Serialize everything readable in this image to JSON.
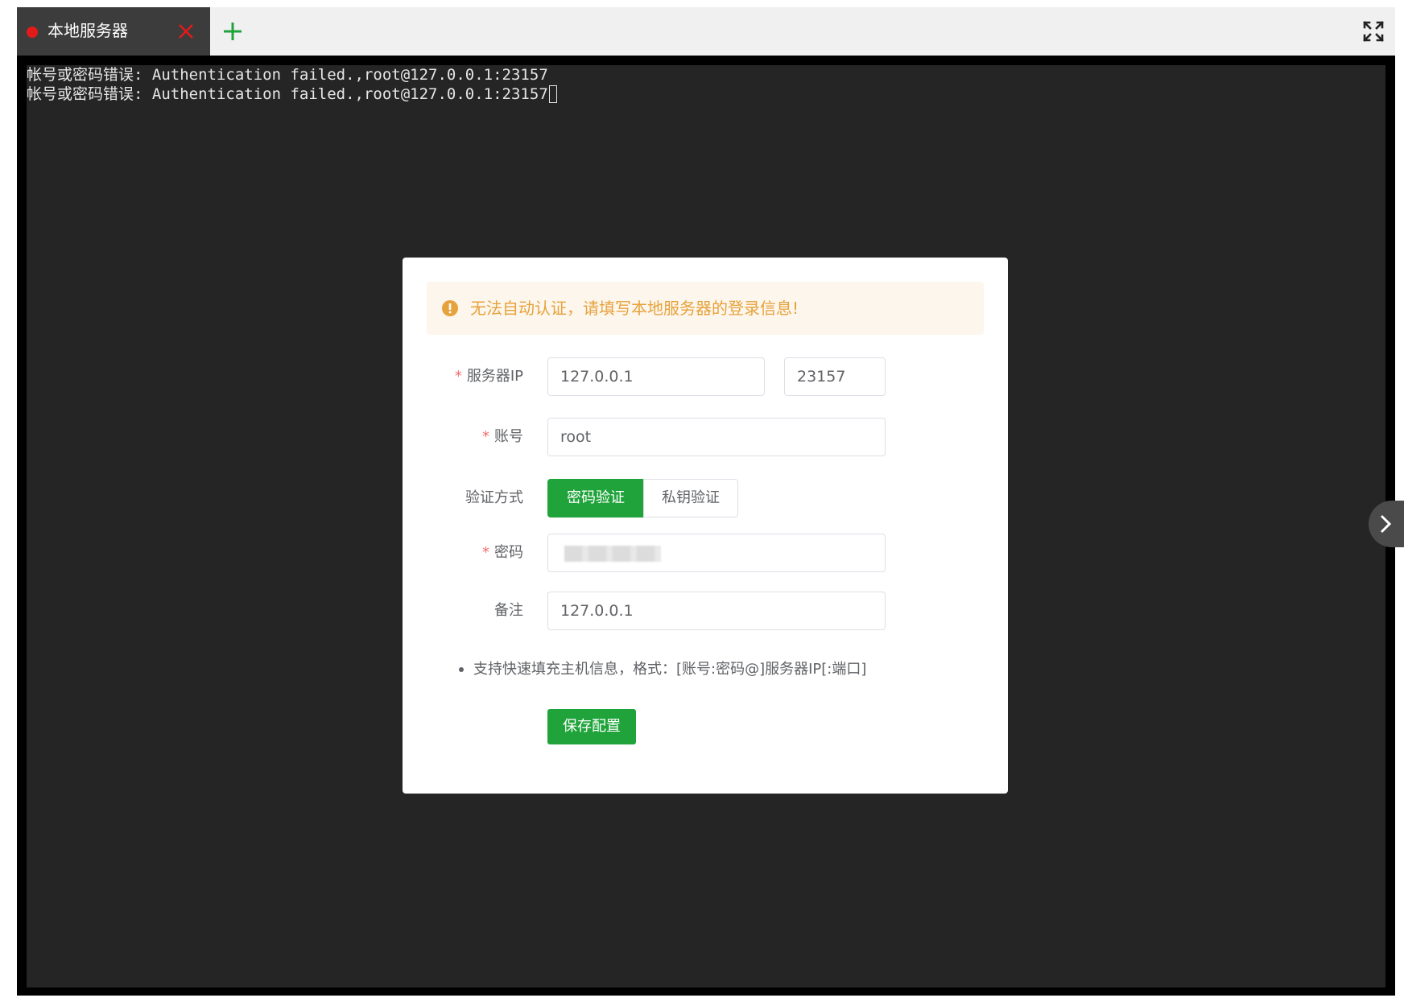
{
  "tabs": [
    {
      "label": "本地服务器",
      "status_color": "#e31a1a",
      "active": true
    }
  ],
  "tabbar": {
    "add_icon": "plus-icon",
    "fullscreen_icon": "fullscreen-icon"
  },
  "terminal": {
    "lines": [
      "帐号或密码错误: Authentication failed.,root@127.0.0.1:23157",
      "帐号或密码错误: Authentication failed.,root@127.0.0.1:23157"
    ]
  },
  "dialog": {
    "alert_text": "无法自动认证，请填写本地服务器的登录信息!",
    "fields": {
      "server_ip_label": "服务器IP",
      "server_ip_value": "127.0.0.1",
      "port_value": "23157",
      "account_label": "账号",
      "account_value": "root",
      "auth_label": "验证方式",
      "auth_options": [
        "密码验证",
        "私钥验证"
      ],
      "auth_selected": "密码验证",
      "password_label": "密码",
      "remark_label": "备注",
      "remark_value": "127.0.0.1"
    },
    "required_mark": "*",
    "tip": "支持快速填充主机信息，格式：[账号:密码@]服务器IP[:端口]",
    "save_button": "保存配置"
  },
  "colors": {
    "accent": "#1fa33a",
    "terminal_bg": "#252525",
    "warning": "#e6a23c",
    "alert_bg": "#fdf6ec",
    "required": "#f56c6c"
  }
}
